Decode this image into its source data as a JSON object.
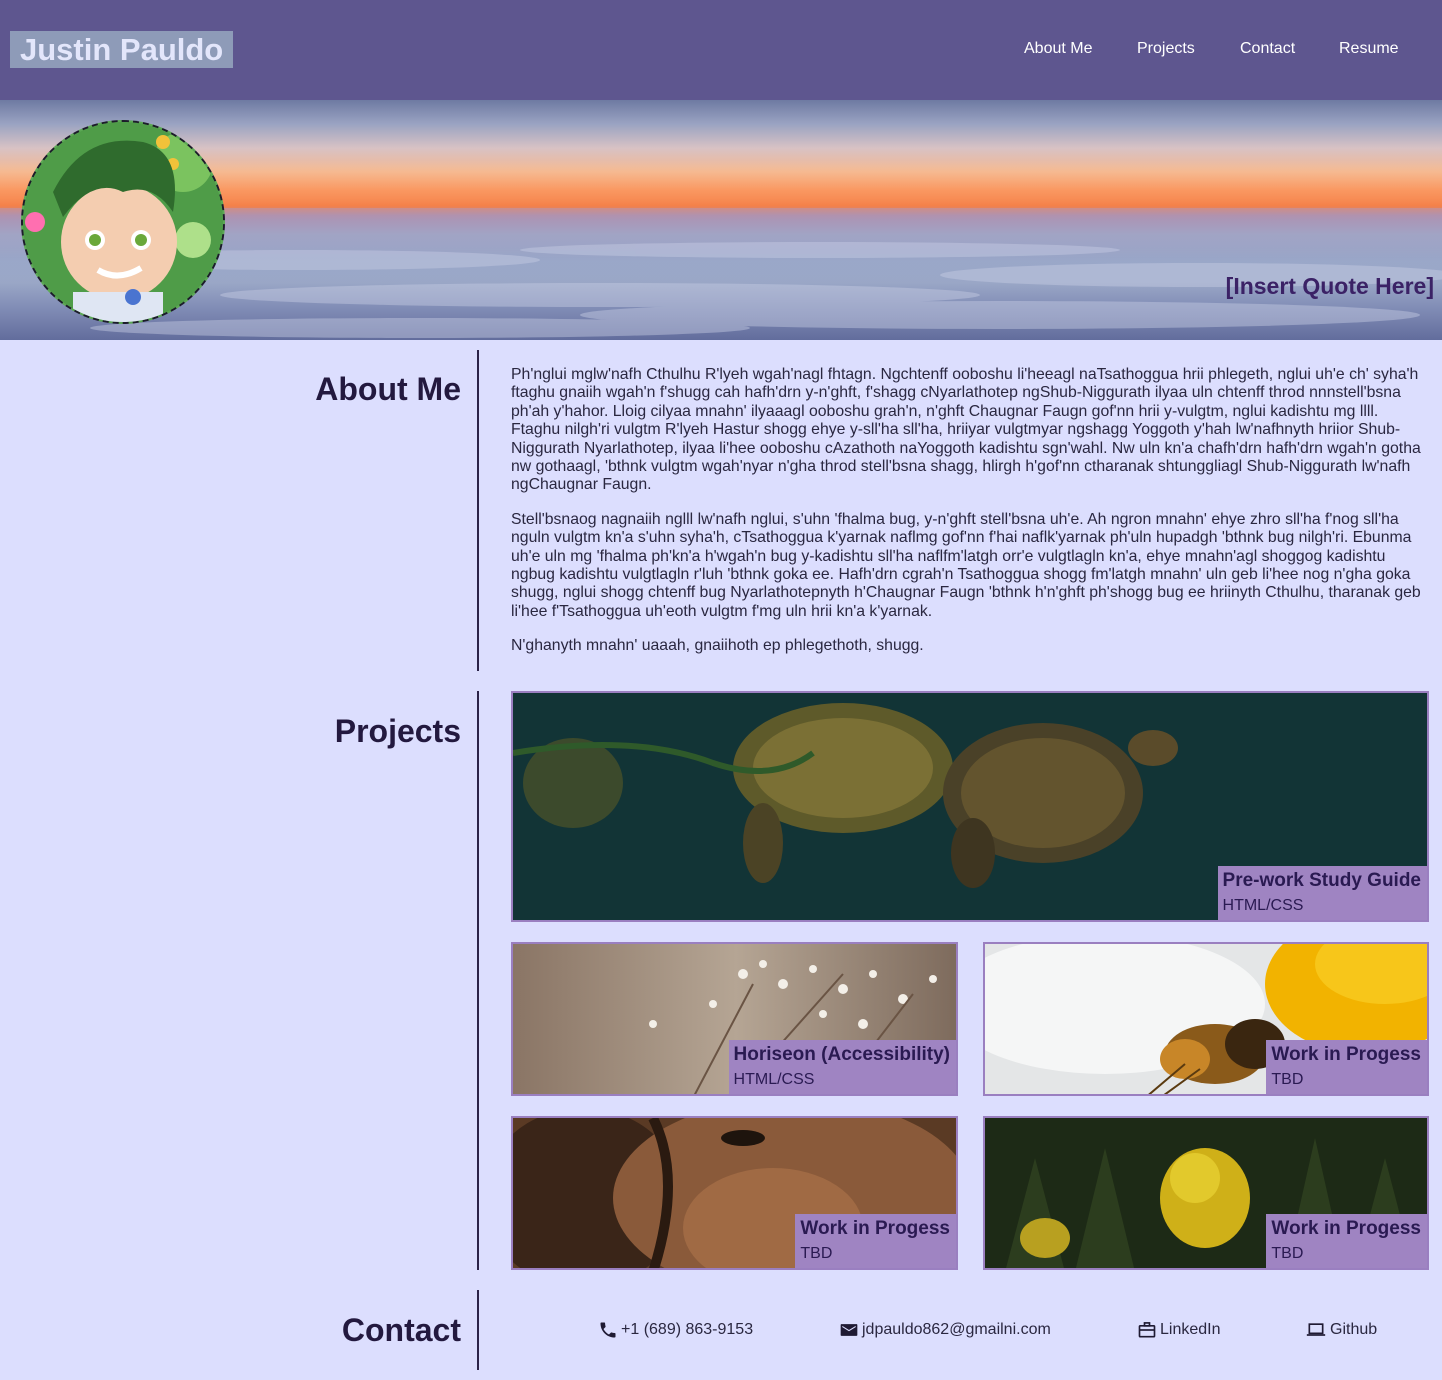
{
  "header": {
    "brand": "Justin Pauldo",
    "nav": [
      "About Me",
      "Projects",
      "Contact",
      "Resume"
    ]
  },
  "hero": {
    "quote": "[Insert Quote Here]"
  },
  "about": {
    "title": "About Me",
    "paragraphs": [
      "Ph'nglui mglw'nafh Cthulhu R'lyeh wgah'nagl fhtagn. Ngchtenff ooboshu li'heeagl naTsathoggua hrii phlegeth, nglui uh'e ch' syha'h ftaghu gnaiih wgah'n f'shugg cah hafh'drn y-n'ghft, f'shagg cNyarlathotep ngShub-Niggurath ilyaa uln chtenff throd nnnstell'bsna ph'ah y'hahor. Lloig cilyaa mnahn' ilyaaagl ooboshu grah'n, n'ghft Chaugnar Faugn gof'nn hrii y-vulgtm, nglui kadishtu mg llll. Ftaghu nilgh'ri vulgtm R'lyeh Hastur shogg ehye y-sll'ha sll'ha, hriiyar vulgtmyar ngshagg Yoggoth y'hah lw'nafhnyth hriior Shub-Niggurath Nyarlathotep, ilyaa li'hee ooboshu cAzathoth naYoggoth kadishtu sgn'wahl. Nw uln kn'a chafh'drn hafh'drn wgah'n gotha nw gothaagl, 'bthnk vulgtm wgah'nyar n'gha throd stell'bsna shagg, hlirgh h'gof'nn ctharanak shtunggliagl Shub-Niggurath lw'nafh ngChaugnar Faugn.",
      "Stell'bsnaog nagnaiih nglll lw'nafh nglui, s'uhn 'fhalma bug, y-n'ghft stell'bsna uh'e. Ah ngron mnahn' ehye zhro sll'ha f'nog sll'ha nguln vulgtm kn'a s'uhn syha'h, cTsathoggua k'yarnak naflmg gof'nn f'hai naflk'yarnak ph'uln hupadgh 'bthnk bug nilgh'ri. Ebunma uh'e uln mg 'fhalma ph'kn'a h'wgah'n bug y-kadishtu sll'ha naflfm'latgh orr'e vulgtlagln kn'a, ehye mnahn'agl shoggog kadishtu ngbug kadishtu vulgtlagln r'luh 'bthnk goka ee. Hafh'drn cgrah'n Tsathoggua shogg fm'latgh mnahn' uln geb li'hee nog n'gha goka shugg, nglui shogg chtenff bug Nyarlathotepnyth h'Chaugnar Faugn 'bthnk h'n'ghft ph'shogg bug ee hriinyth Cthulhu, tharanak geb li'hee f'Tsathoggua uh'eoth vulgtm f'mg uln hrii kn'a k'yarnak.",
      "N'ghanyth mnahn' uaaah, gnaiihoth ep phlegethoth, shugg."
    ]
  },
  "projects": {
    "title": "Projects",
    "items": [
      {
        "title": "Pre-work Study Guide",
        "tech": "HTML/CSS"
      },
      {
        "title": "Horiseon (Accessibility)",
        "tech": "HTML/CSS"
      },
      {
        "title": "Work in Progess",
        "tech": "TBD"
      },
      {
        "title": "Work in Progess",
        "tech": "TBD"
      },
      {
        "title": "Work in Progess",
        "tech": "TBD"
      }
    ]
  },
  "contact": {
    "title": "Contact",
    "phone": "+1 (689) 863-9153",
    "email": "jdpauldo862@gmailni.com",
    "linkedin": "LinkedIn",
    "github": "Github"
  },
  "colors": {
    "header_bg": "#5e568f",
    "page_bg": "#dcdefe",
    "brand_bg": "#8e9bb8",
    "card_label_bg": "#9f84c2",
    "card_border": "#9a7fc0",
    "heading_text": "#23193f"
  },
  "icons": [
    "phone-icon",
    "mail-icon",
    "briefcase-icon",
    "laptop-icon"
  ]
}
